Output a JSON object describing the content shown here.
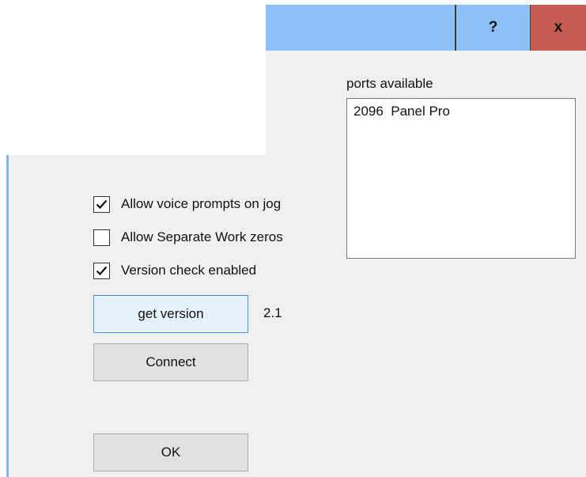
{
  "window": {
    "help_label": "?",
    "close_label": "x"
  },
  "ports": {
    "label": "ports available",
    "items": [
      "2096  Panel Pro"
    ]
  },
  "options": {
    "voice_prompts": {
      "label": "Allow voice prompts on jog",
      "checked": true
    },
    "separate_work_zeros": {
      "label": "Allow Separate Work zeros",
      "checked": false
    },
    "version_check": {
      "label": "Version check enabled",
      "checked": true
    }
  },
  "buttons": {
    "get_version": "get version",
    "connect": "Connect",
    "ok": "OK"
  },
  "version": {
    "value": "2.1"
  },
  "colors": {
    "titlebar": "#8cc0f7",
    "close": "#c75b53",
    "client_bg": "#f0f0f0"
  },
  "icons": {
    "help": "question-mark-icon",
    "close": "close-icon",
    "check": "checkmark-icon"
  }
}
